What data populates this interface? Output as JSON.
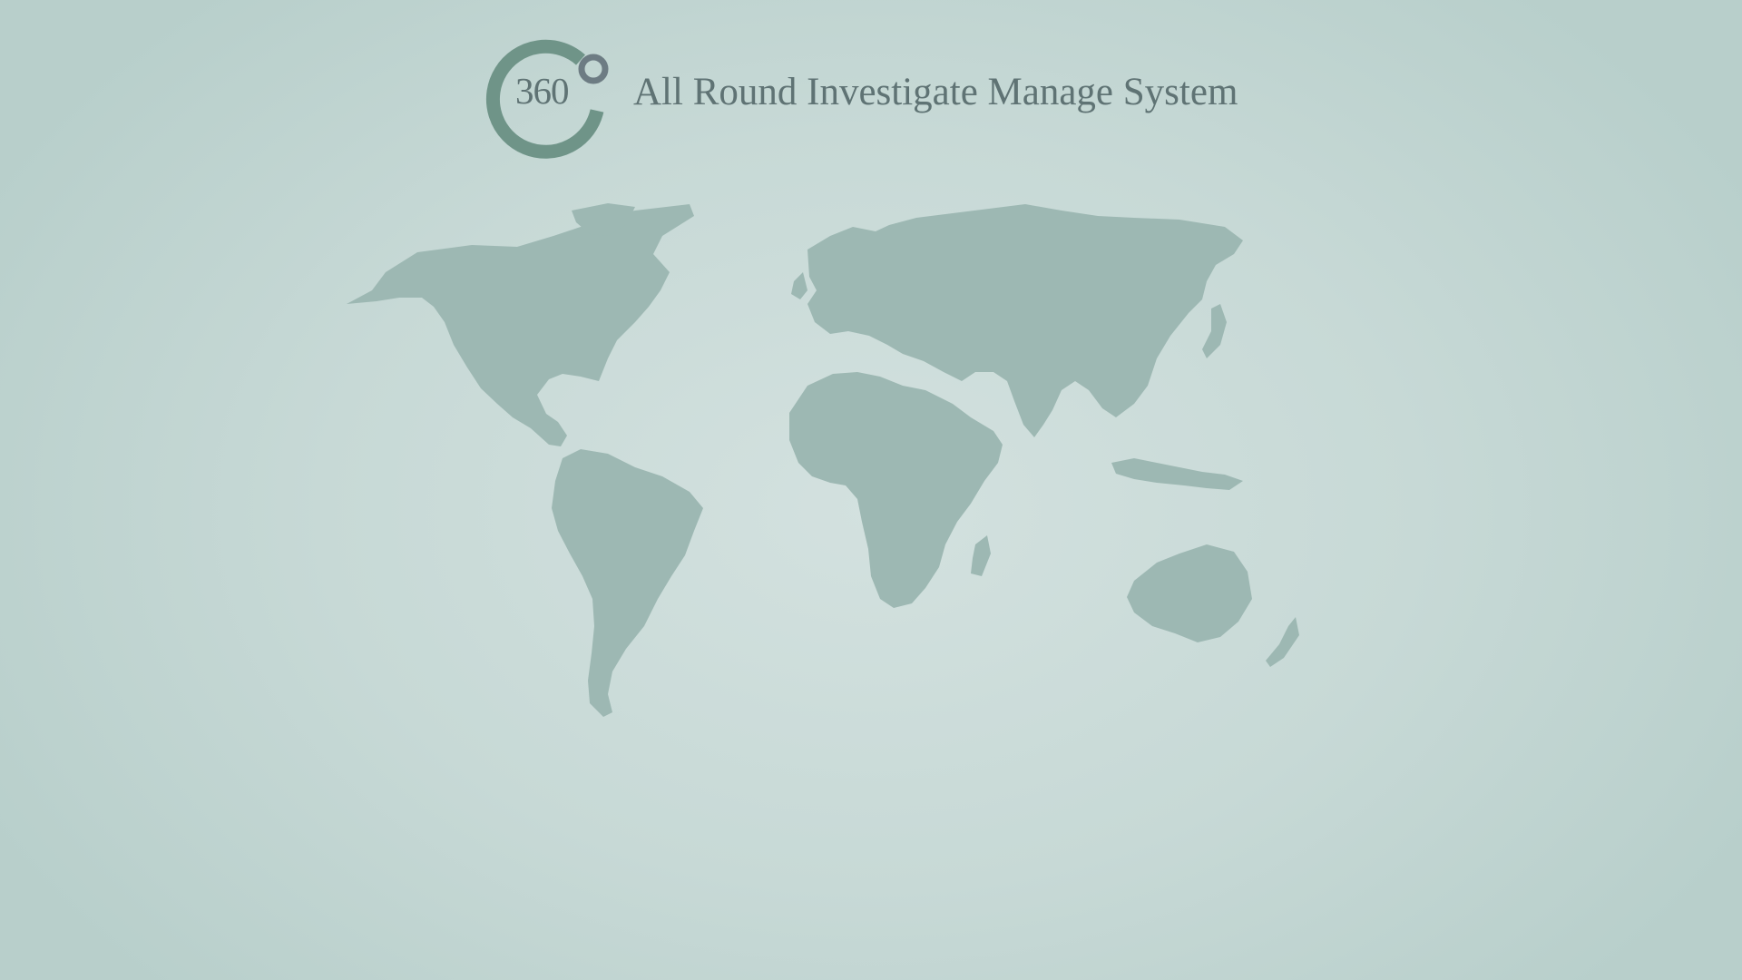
{
  "logo": {
    "text": "360",
    "icon": "degree-ring-logo-icon",
    "ring_color": "#6f9488",
    "dot_color": "#6d7c83"
  },
  "app_title": "All Round Investigate Manage System",
  "background": {
    "center_color": "#d3e1df",
    "edge_color": "#b8cfcb"
  },
  "map": {
    "icon": "world-map-icon",
    "land_color": "#9db8b3"
  }
}
